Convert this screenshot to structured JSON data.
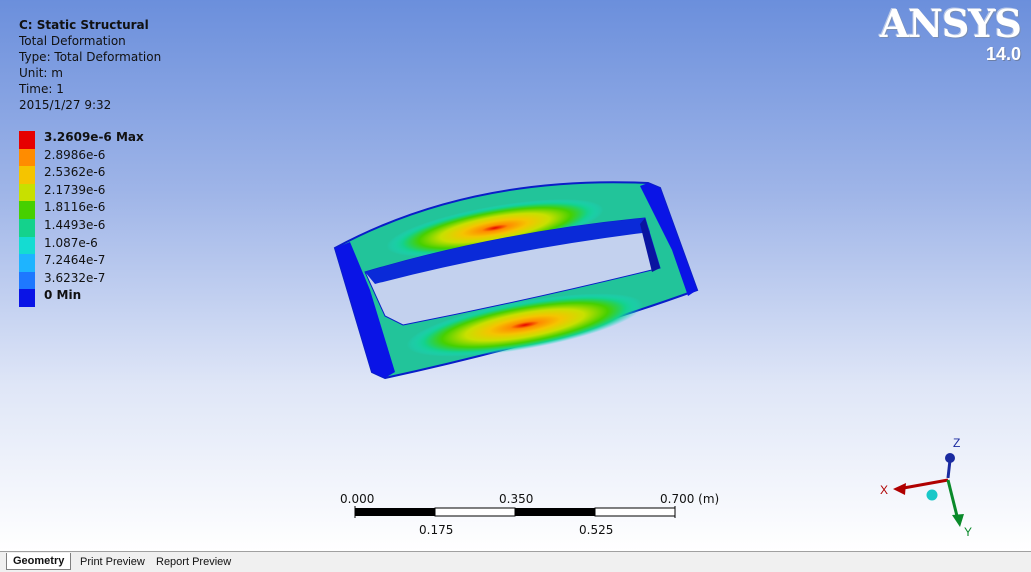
{
  "analysis": {
    "title": "C: Static Structural",
    "result": "Total Deformation",
    "type": "Type: Total Deformation",
    "unit": "Unit: m",
    "time": "Time: 1",
    "date": "2015/1/27 9:32"
  },
  "legend": {
    "entries": [
      {
        "label": "3.2609e-6 Max",
        "color": "#e60000",
        "bold": true
      },
      {
        "label": "2.8986e-6",
        "color": "#ff8c00",
        "bold": false
      },
      {
        "label": "2.5362e-6",
        "color": "#f5c400",
        "bold": false
      },
      {
        "label": "2.1739e-6",
        "color": "#c8e000",
        "bold": false
      },
      {
        "label": "1.8116e-6",
        "color": "#46d000",
        "bold": false
      },
      {
        "label": "1.4493e-6",
        "color": "#14d28c",
        "bold": false
      },
      {
        "label": "1.087e-6",
        "color": "#14dcd2",
        "bold": false
      },
      {
        "label": "7.2464e-7",
        "color": "#1eb4ff",
        "bold": false
      },
      {
        "label": "3.6232e-7",
        "color": "#1e78ff",
        "bold": false
      },
      {
        "label": "0 Min",
        "color": "#0a14e6",
        "bold": true
      }
    ]
  },
  "logo": {
    "brand": "ANSYS",
    "version": "14.0"
  },
  "scale_bar": {
    "top_labels": [
      "0.000",
      "0.350",
      "0.700 (m)"
    ],
    "bottom_labels": [
      "0.175",
      "0.525"
    ]
  },
  "triad": {
    "x": "X",
    "y": "Y",
    "z": "Z"
  },
  "tabs": [
    {
      "label": "Geometry",
      "active": true
    },
    {
      "label": "Print Preview",
      "active": false
    },
    {
      "label": "Report Preview",
      "active": false
    }
  ]
}
